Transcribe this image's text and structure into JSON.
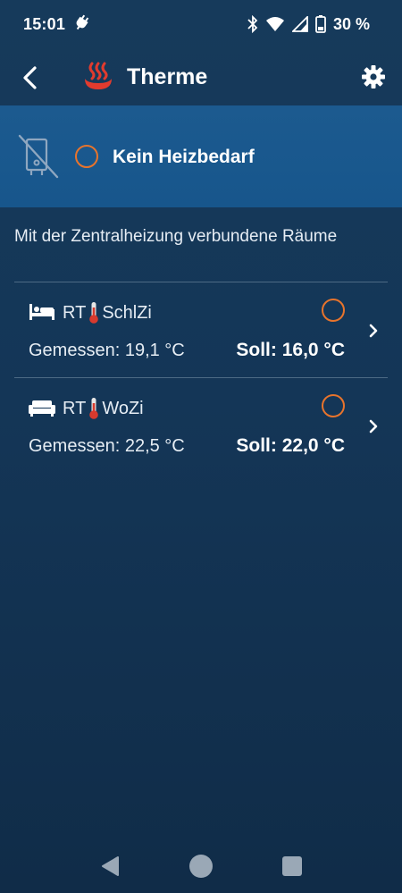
{
  "status_bar": {
    "time": "15:01",
    "battery": "30 %"
  },
  "app_bar": {
    "title": "Therme",
    "back_icon": "back-arrow",
    "settings_icon": "gear"
  },
  "banner": {
    "status_label": "Kein Heizbedarf",
    "icon": "boiler-disconnected",
    "indicator_color": "#e8742c"
  },
  "section": {
    "title": "Mit der Zentralheizung verbundene Räume"
  },
  "rooms": [
    {
      "icon": "bed",
      "name_prefix": "RT",
      "name_suffix": "SchlZi",
      "measured": "Gemessen: 19,1 °C",
      "target": "Soll: 16,0 °C"
    },
    {
      "icon": "sofa",
      "name_prefix": "RT",
      "name_suffix": "WoZi",
      "measured": "Gemessen: 22,5 °C",
      "target": "Soll: 22,0 °C"
    }
  ],
  "colors": {
    "background": "#143657",
    "banner": "#1b5a8f",
    "accent": "#e8742c",
    "flame": "#e23b2e"
  }
}
